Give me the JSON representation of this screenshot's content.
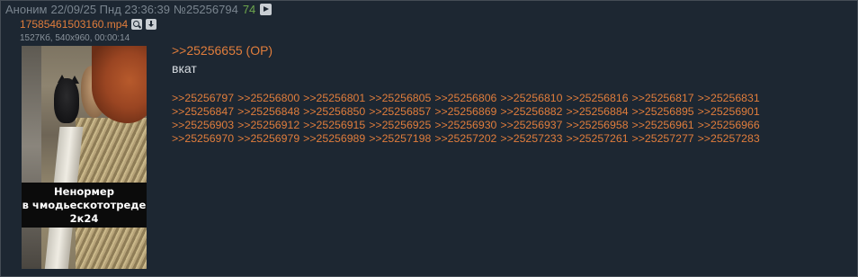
{
  "header": {
    "name": "Аноним",
    "date": "22/09/25 Пнд 23:36:39",
    "post_number": "№25256794",
    "count": "74"
  },
  "file": {
    "name": "17585461503160.mp4",
    "meta": "1527Кб, 540x960, 00:00:14",
    "caption_lines": [
      "Ненормер",
      "в чмодьескототреде",
      "2к24"
    ]
  },
  "post": {
    "op_link": ">>25256655 (OP)",
    "message": "вкат"
  },
  "replies": [
    [
      ">>25256797",
      ">>25256800",
      ">>25256801",
      ">>25256805",
      ">>25256806",
      ">>25256810",
      ">>25256816",
      ">>25256817",
      ">>25256831"
    ],
    [
      ">>25256847",
      ">>25256848",
      ">>25256850",
      ">>25256857",
      ">>25256869",
      ">>25256882",
      ">>25256884",
      ">>25256895",
      ">>25256901"
    ],
    [
      ">>25256903",
      ">>25256912",
      ">>25256915",
      ">>25256925",
      ">>25256930",
      ">>25256937",
      ">>25256958",
      ">>25256961",
      ">>25256966"
    ],
    [
      ">>25256970",
      ">>25256979",
      ">>25256989",
      ">>25257198",
      ">>25257202",
      ">>25257233",
      ">>25257261",
      ">>25257277",
      ">>25257283"
    ]
  ],
  "colors": {
    "background": "#1d2732",
    "link": "#e07d3c",
    "text": "#d8dde2",
    "muted": "#7a858f",
    "count": "#6ea74d"
  },
  "icons": [
    "search-icon",
    "download-icon",
    "play-icon"
  ]
}
